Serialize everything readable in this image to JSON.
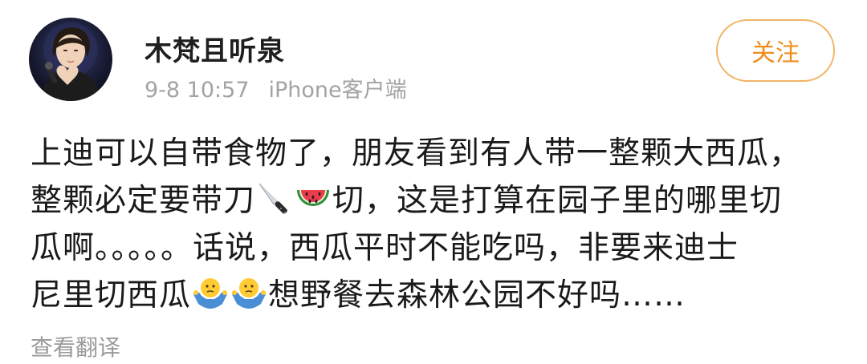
{
  "post": {
    "author": "木梵且听泉",
    "time": "9-8 10:57",
    "source": "iPhone客户端",
    "follow_label": "关注",
    "content": {
      "line1": "上迪可以自带食物了，朋友看到有人带一整颗大西瓜，",
      "line2_a": "整颗必定要带刀",
      "line2_b": "切，这是打算在园子里的哪里切",
      "line3": "瓜啊。。。。。话说，西瓜平时不能吃吗，非要来迪士",
      "line4_a": "尼里切西瓜",
      "line4_b": "想野餐去森林公园不好吗……"
    },
    "translate_label": "查看翻译"
  },
  "icons": {
    "avatar": "avatar-photo",
    "knife": "knife-icon",
    "watermelon": "watermelon-icon",
    "shrug": "shrug-icon"
  },
  "colors": {
    "follow_border": "#f0b566",
    "follow_text": "#f08c1d",
    "meta_text": "#a3a3a3"
  }
}
